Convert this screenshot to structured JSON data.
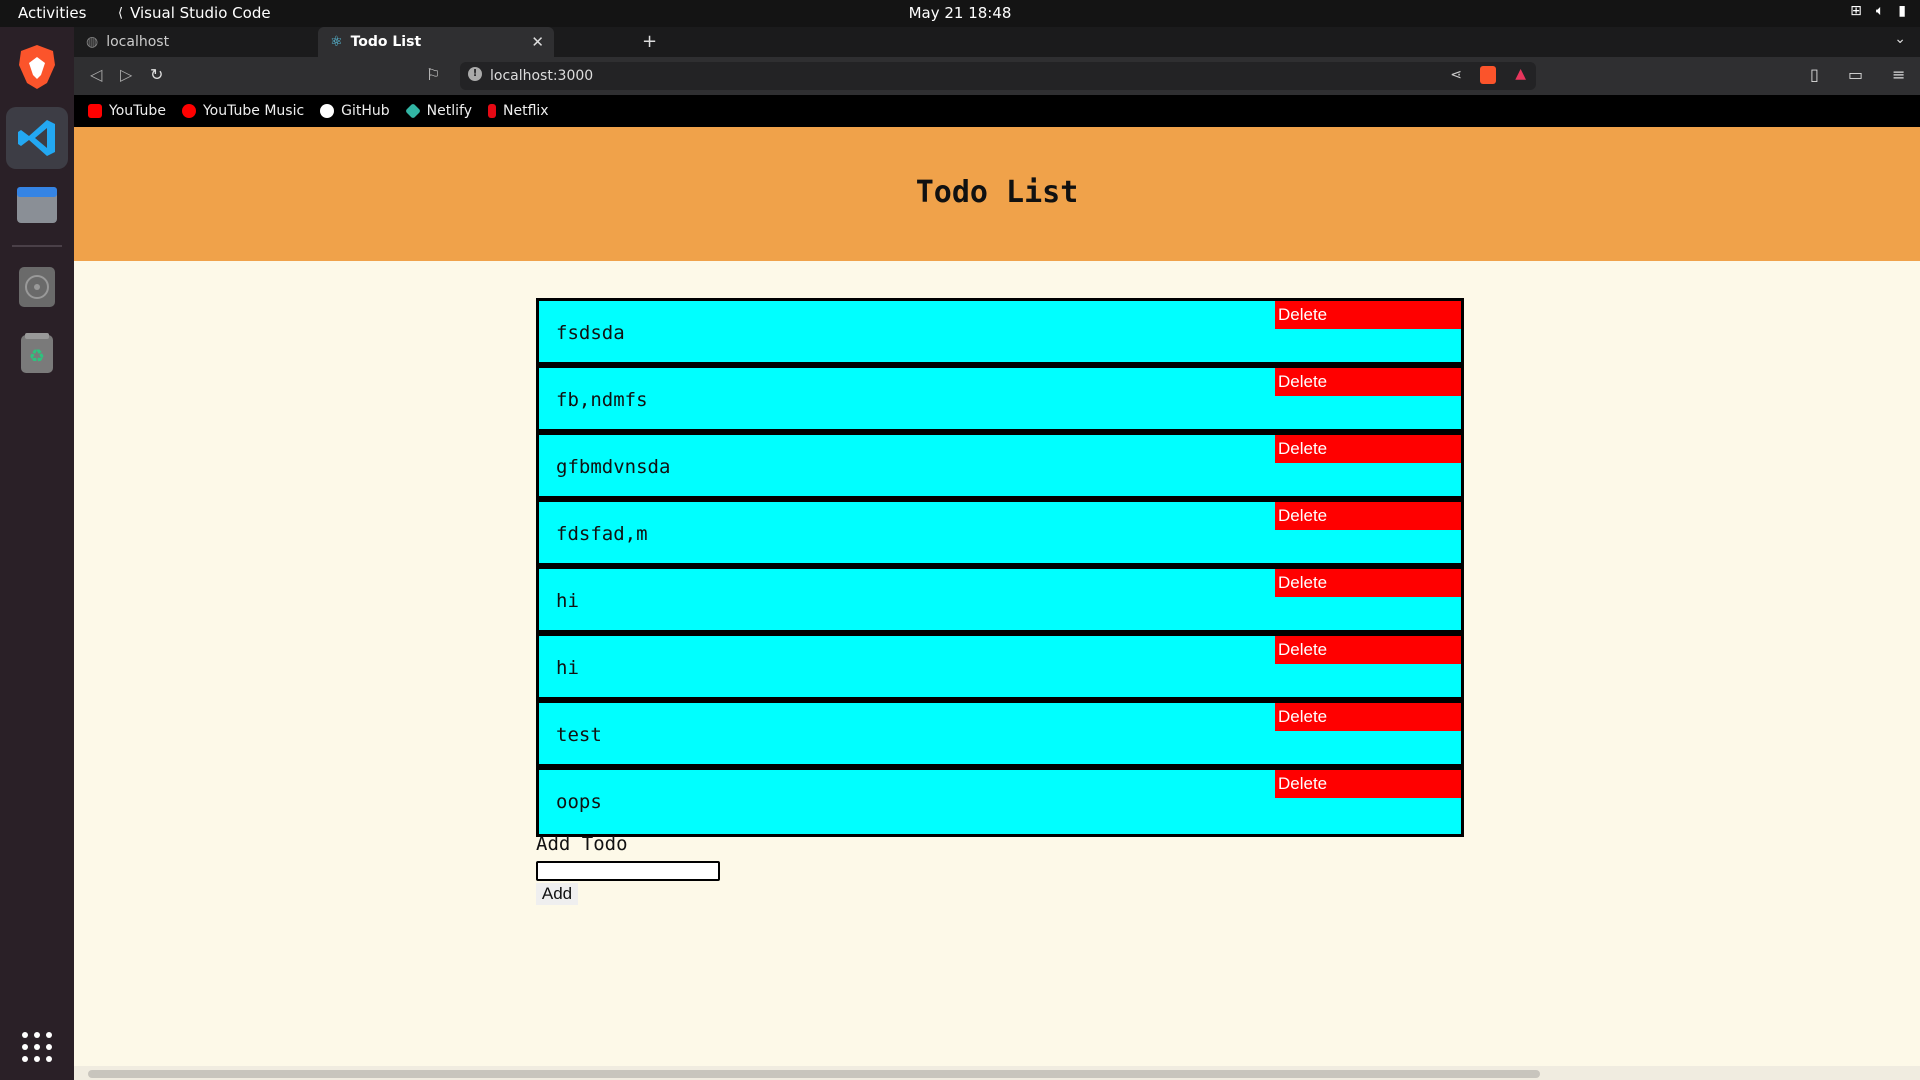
{
  "topbar": {
    "activities": "Activities",
    "app_name": "Visual Studio Code",
    "clock": "May 21  18:48"
  },
  "browser": {
    "tabs": [
      {
        "label": "localhost"
      },
      {
        "label": "Todo List"
      }
    ],
    "url": "localhost:3000",
    "bookmarks": [
      {
        "label": "YouTube",
        "color": "#ff0000"
      },
      {
        "label": "YouTube Music",
        "color": "#ff0000"
      },
      {
        "label": "GitHub",
        "color": "#ffffff"
      },
      {
        "label": "Netlify",
        "color": "#32b5a4"
      },
      {
        "label": "Netflix",
        "color": "#e50914"
      }
    ]
  },
  "app": {
    "title": "Todo List",
    "todos": [
      {
        "text": "fsdsda",
        "delete_label": "Delete"
      },
      {
        "text": "fb,ndmfs",
        "delete_label": "Delete"
      },
      {
        "text": "gfbmdvnsda",
        "delete_label": "Delete"
      },
      {
        "text": "fdsfad,m",
        "delete_label": "Delete"
      },
      {
        "text": "hi",
        "delete_label": "Delete"
      },
      {
        "text": "hi",
        "delete_label": "Delete"
      },
      {
        "text": "test",
        "delete_label": "Delete"
      },
      {
        "text": "oops",
        "delete_label": "Delete"
      }
    ],
    "add_label": "Add Todo",
    "add_input_value": "",
    "add_button": "Add"
  },
  "colors": {
    "header": "#f0a24a",
    "row": "#00ffff",
    "delete": "#ff0000",
    "page": "#fdf9e8"
  }
}
